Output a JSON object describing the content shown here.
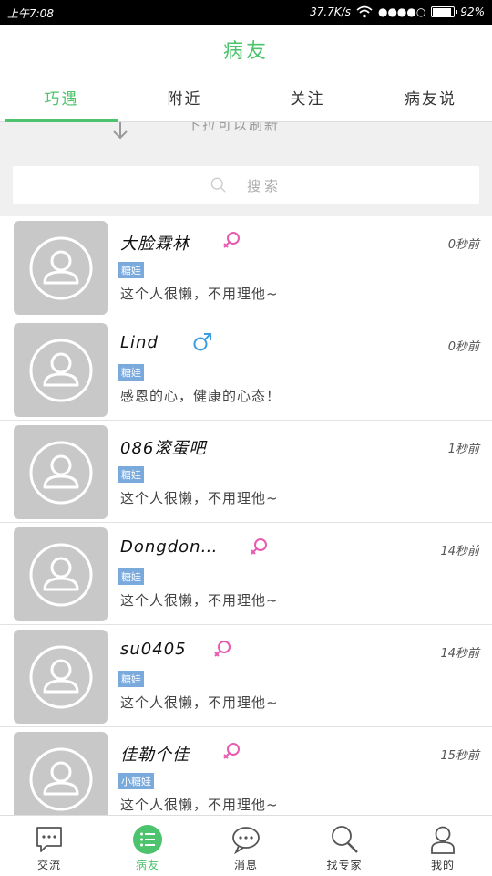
{
  "status_bar": {
    "time": "上午7:08",
    "speed": "37.7K/s",
    "signal": "●●●●○",
    "battery_text": "92%",
    "battery_level": 0.92
  },
  "header": {
    "title": "病友"
  },
  "tabs": [
    {
      "label": "巧遇",
      "active": true
    },
    {
      "label": "附近",
      "active": false
    },
    {
      "label": "关注",
      "active": false
    },
    {
      "label": "病友说",
      "active": false
    }
  ],
  "refresh": {
    "text": "下拉可以刷新"
  },
  "search": {
    "placeholder": "搜索"
  },
  "users": [
    {
      "name": "大脸霖林",
      "gender": "female",
      "time": "0秒前",
      "badge": "糖娃",
      "signature": "这个人很懒，不用理他~"
    },
    {
      "name": "Lind",
      "gender": "male",
      "time": "0秒前",
      "badge": "糖娃",
      "signature": "感恩的心，健康的心态！"
    },
    {
      "name": "086滚蛋吧",
      "gender": "none",
      "time": "1秒前",
      "badge": "糖娃",
      "signature": "这个人很懒，不用理他~"
    },
    {
      "name": "Dongdon…",
      "gender": "female",
      "time": "14秒前",
      "badge": "糖娃",
      "signature": "这个人很懒，不用理他~"
    },
    {
      "name": "su0405",
      "gender": "female",
      "time": "14秒前",
      "badge": "糖娃",
      "signature": "这个人很懒，不用理他~"
    },
    {
      "name": "佳勒个佳",
      "gender": "female",
      "time": "15秒前",
      "badge": "小糖娃",
      "signature": "这个人很懒，不用理他~"
    }
  ],
  "bottom_nav": [
    {
      "label": "交流",
      "icon": "chat-bubble-icon",
      "active": false
    },
    {
      "label": "病友",
      "icon": "list-icon",
      "active": true
    },
    {
      "label": "消息",
      "icon": "message-icon",
      "active": false
    },
    {
      "label": "找专家",
      "icon": "search-icon",
      "active": false
    },
    {
      "label": "我的",
      "icon": "person-icon",
      "active": false
    }
  ],
  "colors": {
    "accent": "#4cc36c",
    "female": "#e85ab0",
    "male": "#3a9ee0",
    "badge": "#7aa9dc",
    "avatar": "#c8c8c8"
  }
}
